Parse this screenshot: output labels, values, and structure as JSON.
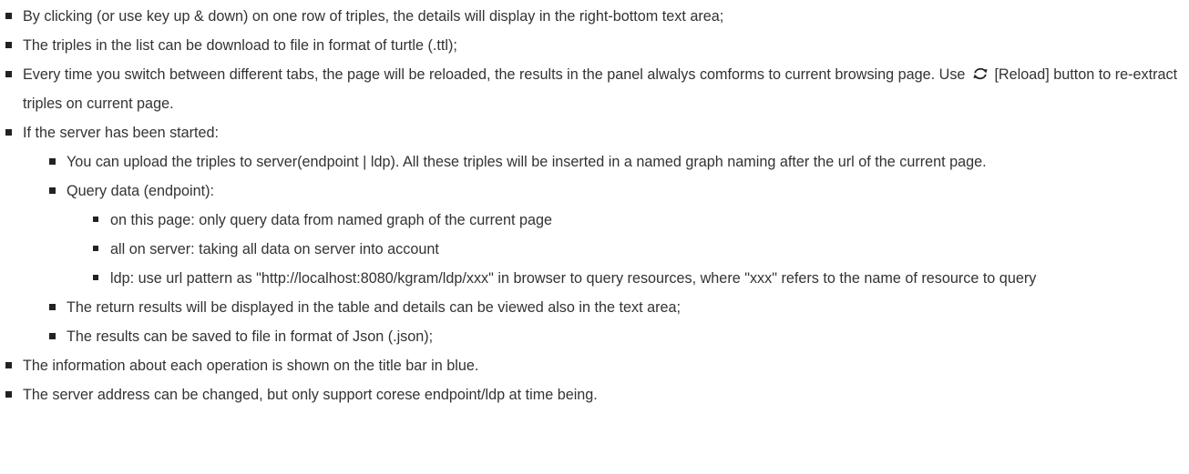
{
  "items": [
    "By clicking (or use key up & down) on one row of triples, the details will display in the right-bottom text area;",
    "The triples in the list can be download to file in format of turtle (.ttl);",
    {
      "before_icon": "Every time you switch between different tabs, the page will be reloaded, the results in the panel alwalys comforms to current browsing page. Use",
      "icon": "reload-icon",
      "after_icon": "[Reload] button to re-extract triples on current page."
    },
    {
      "text": "If the server has been started:",
      "children": [
        "You can upload the triples to server(endpoint | ldp). All these triples will be inserted in a named graph naming after the url of the current page.",
        {
          "text": "Query data (endpoint):",
          "children": [
            "on this page: only query data from named graph of the current page",
            "all on server: taking all data on server into account",
            "ldp: use url pattern as \"http://localhost:8080/kgram/ldp/xxx\" in browser to query resources, where \"xxx\" refers to the name of resource to query"
          ]
        },
        "The return results will be displayed in the table and details can be viewed also in the text area;",
        "The results can be saved to file in format of Json (.json);"
      ]
    },
    "The information about each operation is shown on the title bar in blue.",
    "The server address can be changed, but only support corese endpoint/ldp at time being."
  ]
}
